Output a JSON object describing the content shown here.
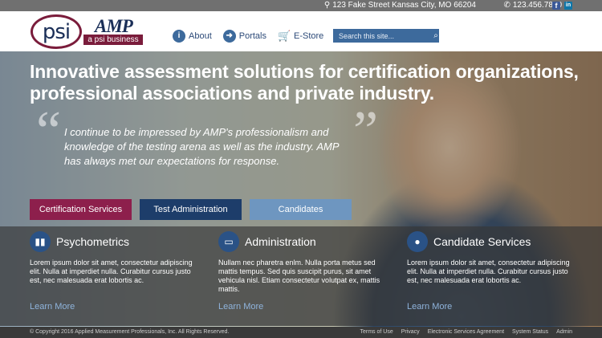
{
  "topbar": {
    "address": "123 Fake Street Kansas City, MO 66204",
    "phone": "123.456.7890",
    "facebook_letter": "f",
    "linkedin_letter": "in"
  },
  "header": {
    "logo_psi": "psi",
    "logo_amp": "AMP",
    "logo_tagline": "a psi business",
    "nav": [
      {
        "label": "About",
        "icon": "info-icon"
      },
      {
        "label": "Portals",
        "icon": "arrow-right-icon"
      },
      {
        "label": "E-Store",
        "icon": "cart-icon"
      }
    ],
    "search_placeholder": "Search this site..."
  },
  "hero": {
    "headline": "Innovative assessment solutions for certification organizations, professional associations and private industry.",
    "quote": "I continue to be impressed by AMP's professionalism and knowledge of the testing arena as well as the industry. AMP has always met our expectations for response.",
    "buttons": [
      {
        "label": "Certification Services",
        "color": "#8d1f4c"
      },
      {
        "label": "Test Administration",
        "color": "#1d3d6a"
      },
      {
        "label": "Candidates",
        "color": "#6e96c0"
      }
    ]
  },
  "columns": [
    {
      "title": "Psychometrics",
      "icon": "bar-chart-icon",
      "text": "Lorem ipsum dolor sit amet, consectetur adipiscing elit. Nulla at imperdiet nulla. Curabitur cursus justo est, nec malesuada erat lobortis ac.",
      "link": "Learn More"
    },
    {
      "title": "Administration",
      "icon": "monitor-icon",
      "text": "Nullam nec pharetra enlm. Nulla porta metus sed mattis tempus. Sed quis suscipit purus, sit amet vehicula nisl. Etiam consectetur volutpat ex, mattis mattis.",
      "link": "Learn More"
    },
    {
      "title": "Candidate Services",
      "icon": "user-icon",
      "text": "Lorem ipsum dolor sit amet, consectetur adipiscing elit. Nulla at imperdiet nulla. Curabitur cursus justo est, nec malesuada erat lobortis ac.",
      "link": "Learn More"
    }
  ],
  "footer": {
    "copyright": "© Copyright 2016 Applied Measurement Professionals, Inc. All Rights Reserved.",
    "links": [
      "Terms of Use",
      "Privacy",
      "Electronic Services Agreement",
      "System Status",
      "Admin"
    ]
  },
  "colors": {
    "brand_maroon": "#7a1c3b",
    "brand_navy": "#1a2e57",
    "accent_blue": "#3d6a9c"
  }
}
